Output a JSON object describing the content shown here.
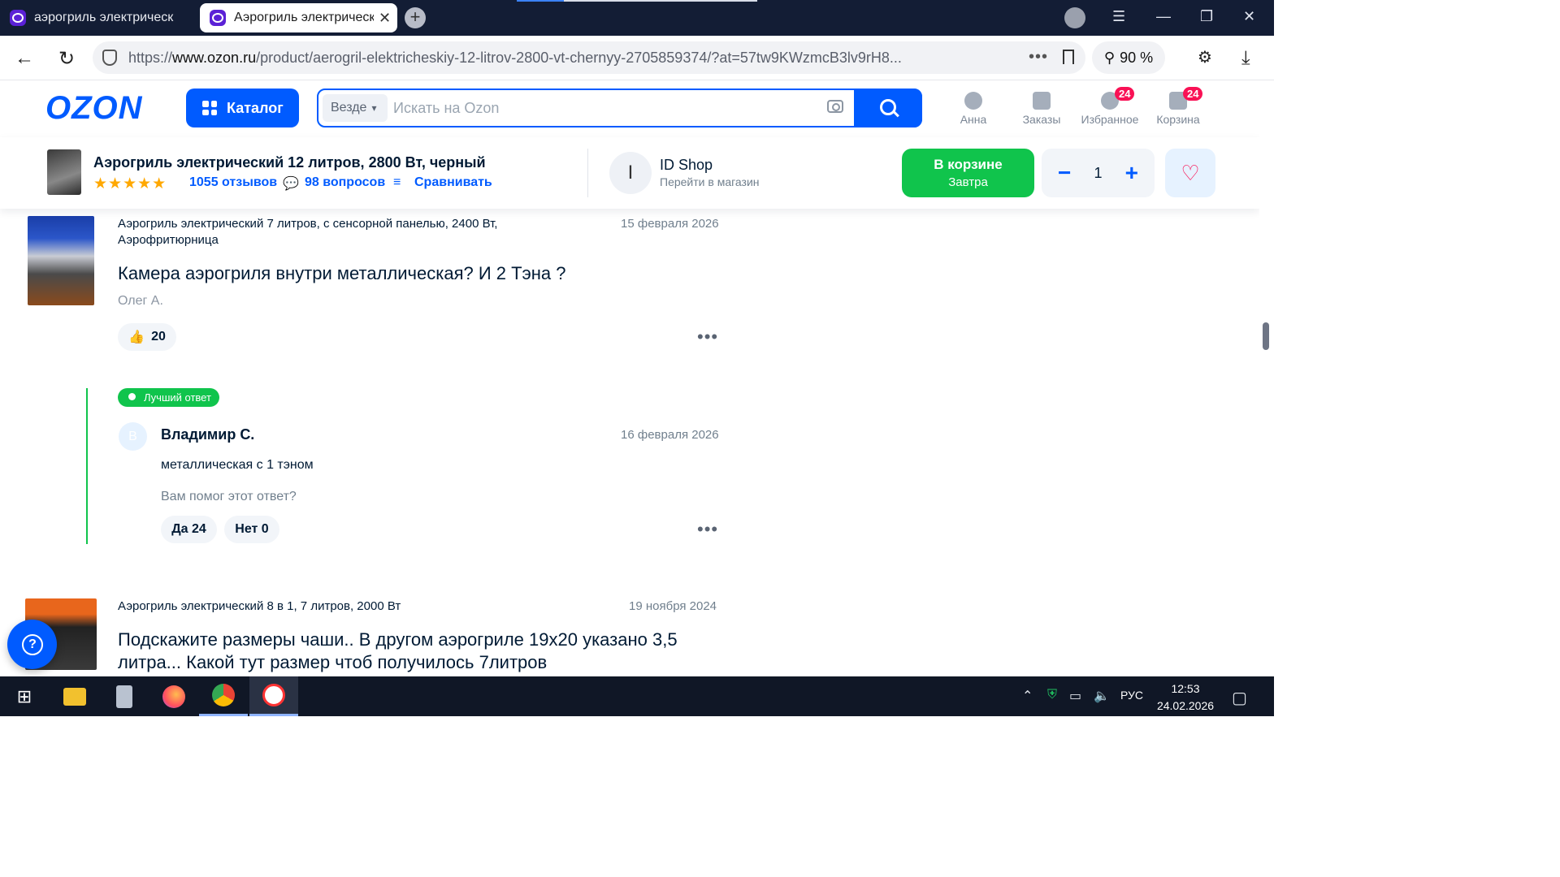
{
  "browser": {
    "tabs": [
      {
        "title": "аэрогриль электрический"
      },
      {
        "title": "Аэрогриль электрический"
      }
    ],
    "url_prefix": "https://",
    "url_domain": "www.ozon.ru",
    "url_path": "/product/aerogril-elektricheskiy-12-litrov-2800-vt-chernyy-2705859374/?at=57tw9KWzmcB3lv9rH8...",
    "zoom": "90 %"
  },
  "header": {
    "logo": "OZON",
    "catalog_label": "Каталог",
    "search_scope": "Везде",
    "search_placeholder": "Искать на Ozon",
    "icons": [
      {
        "label": "Анна",
        "badge": ""
      },
      {
        "label": "Заказы",
        "badge": ""
      },
      {
        "label": "Избранное",
        "badge": "24"
      },
      {
        "label": "Корзина",
        "badge": "24"
      }
    ]
  },
  "product_bar": {
    "title": "Аэрогриль электрический 12 литров, 2800 Вт, черный",
    "stars": "★★★★★",
    "rating": 5,
    "reviews": "1055 отзывов",
    "questions": "98 вопросов",
    "compare": "Сравнивать",
    "shop_initial": "I",
    "shop_name": "ID Shop",
    "shop_link": "Перейти в магазин",
    "cart_button": "В корзине",
    "cart_sub": "Завтра",
    "quantity": "1",
    "minus": "−",
    "plus": "+"
  },
  "questions": [
    {
      "product": "Аэрогриль электрический 7 литров, с сенсорной панелью, 2400 Вт, Аэрофритюрница",
      "date": "15 февраля 2026",
      "text": "Камера аэрогриля внутри металлическая? И 2 Тэна ?",
      "author": "Олег А.",
      "likes": "20",
      "answer": {
        "badge": "Лучший ответ",
        "avatar": "В",
        "author": "Владимир С.",
        "date": "16 февраля 2026",
        "text": "металлическая с 1 тэном",
        "helped_q": "Вам помог этот ответ?",
        "yes": "Да 24",
        "no": "Нет 0"
      }
    },
    {
      "product": "Аэрогриль электрический 8 в 1, 7 литров, 2000 Вт",
      "date": "19 ноября 2024",
      "text": "Подскажите размеры чаши.. В другом аэрогриле 19х20 указано 3,5 литра... Какой тут размер чтоб получилось 7литров"
    }
  ],
  "taskbar": {
    "lang": "РУС",
    "time": "12:53",
    "date": "24.02.2026"
  }
}
